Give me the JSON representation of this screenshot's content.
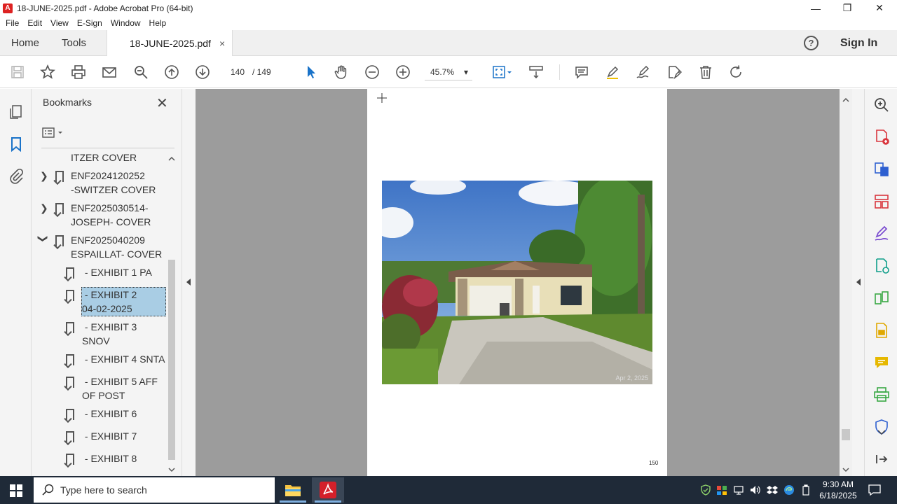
{
  "window": {
    "title": "18-JUNE-2025.pdf - Adobe Acrobat Pro (64-bit)",
    "minimize": "—",
    "restore": "❐",
    "close": "✕"
  },
  "menu": [
    "File",
    "Edit",
    "View",
    "E-Sign",
    "Window",
    "Help"
  ],
  "tabs": {
    "home": "Home",
    "tools": "Tools",
    "document": "18-JUNE-2025.pdf",
    "document_close": "×",
    "help": "?",
    "sign_in": "Sign In"
  },
  "toolbar": {
    "current_page": "140",
    "page_total": "/  149",
    "zoom": "45.7%",
    "zoom_caret": "▾"
  },
  "bookmarks": {
    "title": "Bookmarks",
    "close": "✕",
    "items": [
      {
        "label": "ITZER COVER"
      },
      {
        "label": "ENF2024120252\n-SWITZER COVER"
      },
      {
        "label": "ENF2025030514-\nJOSEPH- COVER"
      },
      {
        "label": "ENF2025040209\nESPAILLAT- COVER"
      },
      {
        "label": " - EXHIBIT 1 PA"
      },
      {
        "label": " - EXHIBIT 2\n04-02-2025"
      },
      {
        "label": " - EXHIBIT 3\nSNOV"
      },
      {
        "label": " - EXHIBIT 4 SNTA"
      },
      {
        "label": " - EXHIBIT 5 AFF\nOF POST"
      },
      {
        "label": " - EXHIBIT 6"
      },
      {
        "label": " - EXHIBIT 7"
      },
      {
        "label": " - EXHIBIT 8"
      }
    ]
  },
  "page": {
    "photo_date": "Apr 2, 2025",
    "footer_number": "150"
  },
  "taskbar": {
    "search_placeholder": "Type here to search",
    "time": "9:30 AM",
    "date": "6/18/2025"
  }
}
